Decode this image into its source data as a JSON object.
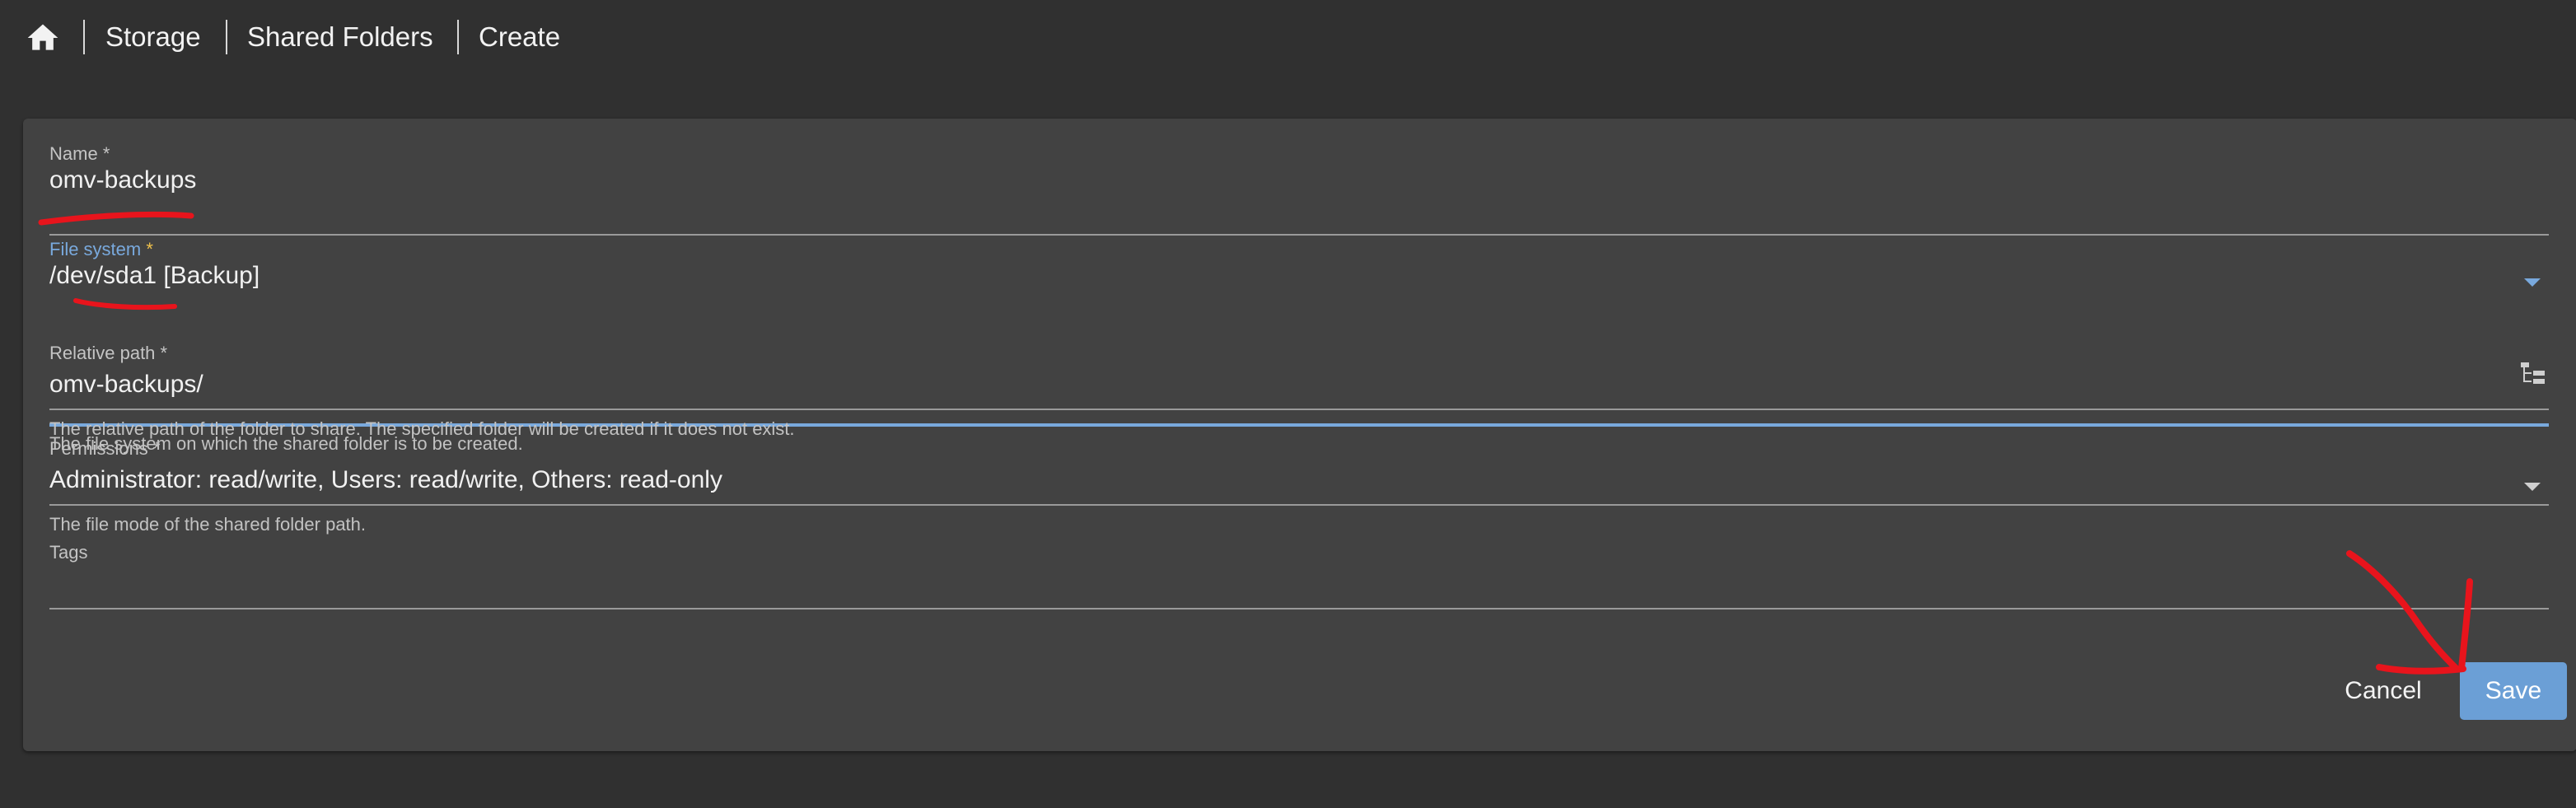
{
  "breadcrumb": {
    "home_icon": "home-icon",
    "items": [
      "Storage",
      "Shared Folders",
      "Create"
    ]
  },
  "form": {
    "name": {
      "label": "Name",
      "required": "*",
      "value": "omv-backups"
    },
    "file_system": {
      "label": "File system",
      "required": "*",
      "value": "/dev/sda1 [Backup]",
      "hint": "The file system on which the shared folder is to be created."
    },
    "relative_path": {
      "label": "Relative path",
      "required": "*",
      "value": "omv-backups/",
      "hint": "The relative path of the folder to share. The specified folder will be created if it does not exist.",
      "icon": "folder-tree-icon"
    },
    "permissions": {
      "label": "Permissions",
      "required": "*",
      "value": "Administrator: read/write, Users: read/write, Others: read-only",
      "hint": "The file mode of the shared folder path."
    },
    "tags": {
      "label": "Tags",
      "value": ""
    }
  },
  "actions": {
    "cancel_label": "Cancel",
    "save_label": "Save"
  },
  "colors": {
    "background": "#303030",
    "card": "#424242",
    "accent": "#79a9dd",
    "save_button": "#6b9fd6",
    "focus_star": "#f0c24b",
    "annotation": "#e8141c"
  }
}
